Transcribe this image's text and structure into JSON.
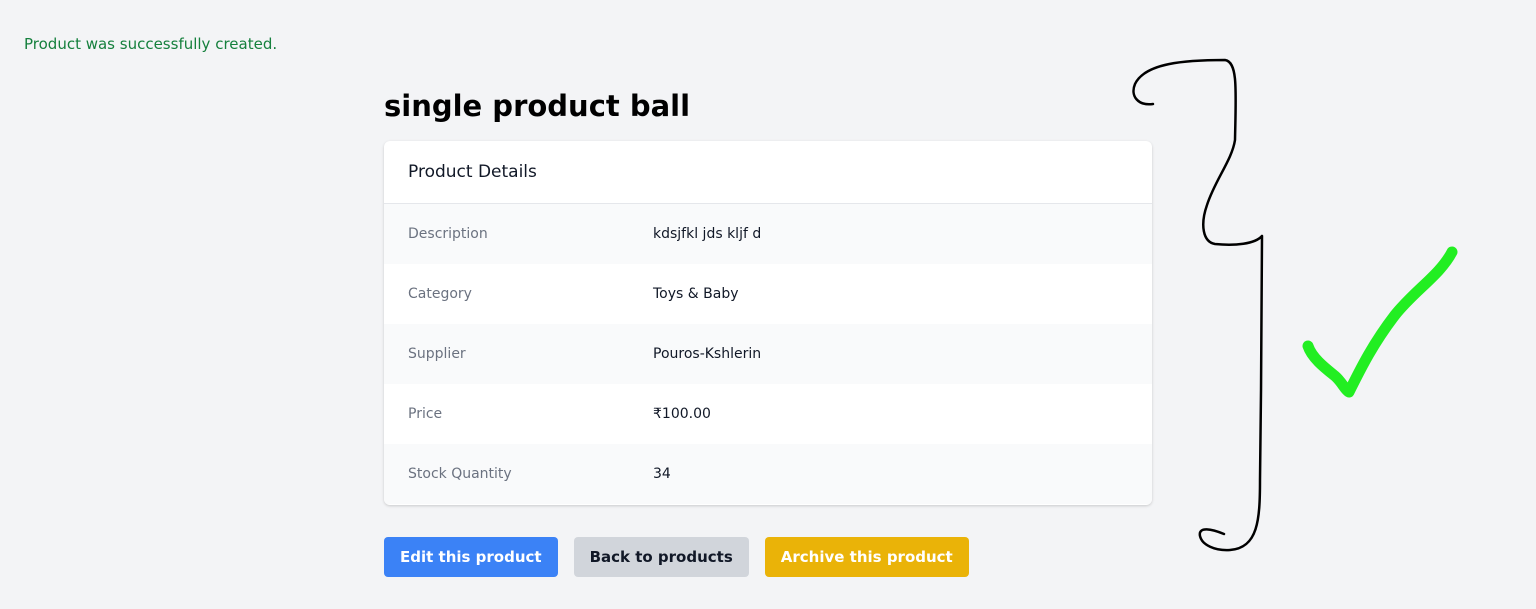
{
  "flash": {
    "message": "Product was successfully created."
  },
  "product": {
    "title": "single product ball"
  },
  "card": {
    "header": "Product Details",
    "rows": [
      {
        "label": "Description",
        "value": "kdsjfkl jds kljf d"
      },
      {
        "label": "Category",
        "value": "Toys & Baby"
      },
      {
        "label": "Supplier",
        "value": "Pouros-Kshlerin"
      },
      {
        "label": "Price",
        "value": "₹100.00"
      },
      {
        "label": "Stock Quantity",
        "value": "34"
      }
    ]
  },
  "actions": {
    "edit_label": "Edit this product",
    "back_label": "Back to products",
    "archive_label": "Archive this product"
  },
  "colors": {
    "flash_text": "#15803d",
    "edit_button": "#3b82f6",
    "back_button": "#d1d5db",
    "archive_button": "#eab308",
    "checkmark": "#22ee22"
  },
  "annotations": {
    "bracket": "hand-drawn-bracket",
    "check": "hand-drawn-checkmark"
  }
}
